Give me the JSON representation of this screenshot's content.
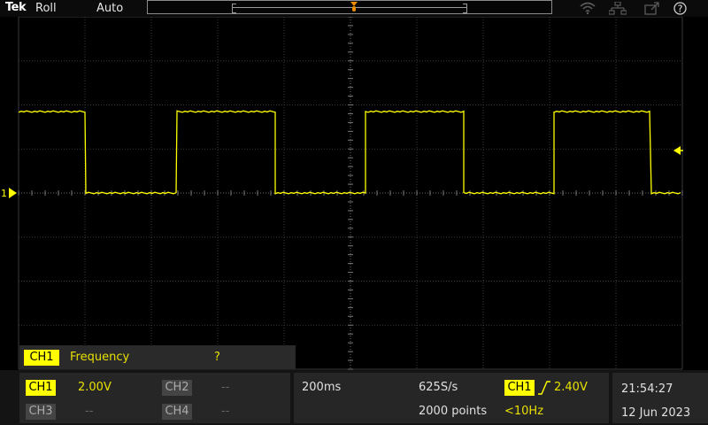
{
  "topbar": {
    "brand": "Tek",
    "acquisition_mode": "Roll",
    "trigger_mode": "Auto",
    "icons": [
      "wifi-icon",
      "network-icon",
      "export-icon",
      "help-icon"
    ],
    "help_glyph": "?"
  },
  "colors": {
    "ch1": "#ffff00",
    "background": "#000000",
    "grid": "#3a3a3a",
    "panel": "#262626"
  },
  "waveform": {
    "channel_marker": "1",
    "sample_levels": [
      1,
      1,
      1,
      0,
      0,
      0,
      1,
      1,
      1,
      0,
      0,
      0,
      1,
      1,
      1,
      0,
      0,
      0,
      1,
      1,
      1,
      0,
      0,
      0,
      1,
      1,
      1,
      0,
      0,
      0,
      1,
      1,
      1,
      0,
      0,
      0
    ],
    "note_levels": "high / low states per division-slot"
  },
  "measurement": {
    "channel": "CH1",
    "name": "Frequency",
    "value": "?"
  },
  "channels": [
    {
      "label": "CH1",
      "value": "2.00V",
      "active": true
    },
    {
      "label": "CH2",
      "value": "--",
      "active": false
    },
    {
      "label": "CH3",
      "value": "--",
      "active": false
    },
    {
      "label": "CH4",
      "value": "--",
      "active": false
    }
  ],
  "horizontal": {
    "scale": "200ms",
    "sample_rate": "625S/s",
    "record_length": "2000 points"
  },
  "trigger": {
    "source": "CH1",
    "level": "2.40V",
    "frequency": "<10Hz"
  },
  "clock": {
    "time": "21:54:27",
    "date": "12 Jun 2023"
  }
}
